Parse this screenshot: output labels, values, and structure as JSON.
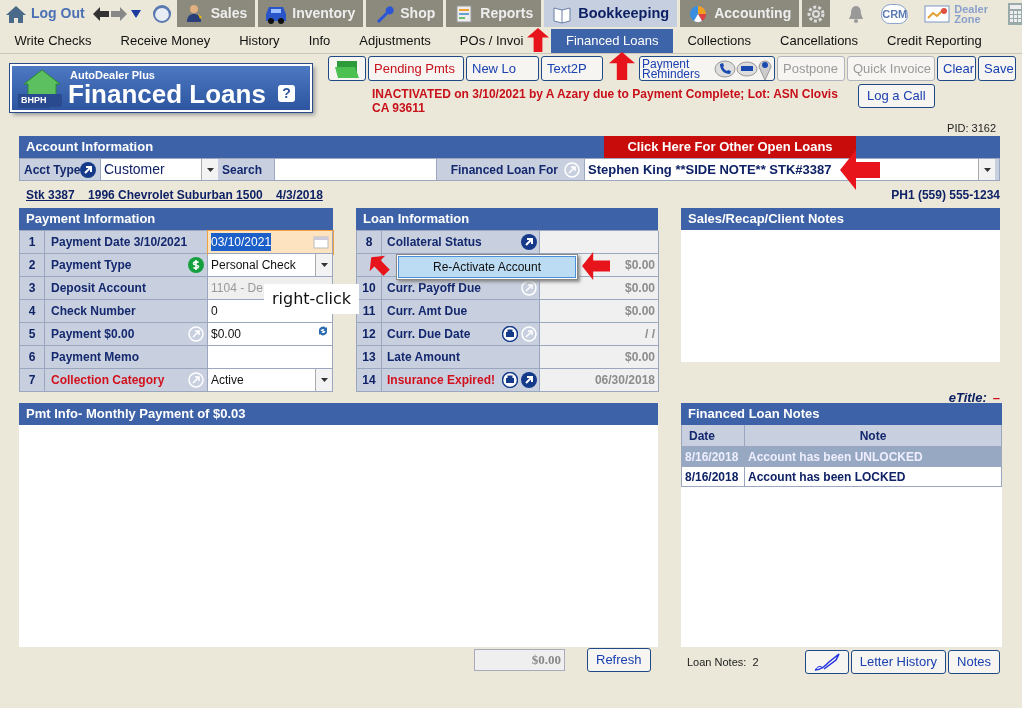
{
  "header": {
    "logout": "Log Out",
    "modules": [
      {
        "label": "Sales",
        "kind": "sales",
        "selected": false
      },
      {
        "label": "Inventory",
        "kind": "inventory",
        "selected": false
      },
      {
        "label": "Shop",
        "kind": "shop",
        "selected": false
      },
      {
        "label": "Reports",
        "kind": "reports",
        "selected": false
      },
      {
        "label": "Bookkeeping",
        "kind": "bookkeeping",
        "selected": true
      },
      {
        "label": "Accounting",
        "kind": "accounting",
        "selected": false
      }
    ],
    "crm": "CRM",
    "dealer_zone": "Dealer Zone"
  },
  "subnav": [
    {
      "label": "Write Checks",
      "selected": false
    },
    {
      "label": "Receive Money",
      "selected": false
    },
    {
      "label": "History",
      "selected": false
    },
    {
      "label": "Info",
      "selected": false
    },
    {
      "label": "Adjustments",
      "selected": false
    },
    {
      "label": "POs / Invoi",
      "selected": false
    },
    {
      "label": "Financed Loans",
      "selected": true
    },
    {
      "label": "Collections",
      "selected": false
    },
    {
      "label": "Cancellations",
      "selected": false
    },
    {
      "label": "Credit Reporting",
      "selected": false
    }
  ],
  "logo": {
    "badge": "BHPH",
    "brand": "AutoDealer Plus",
    "title": "Financed Loans",
    "help": "?"
  },
  "toolbar": [
    {
      "kind": "folder",
      "alert": false,
      "disabled": false
    },
    {
      "kind": "text",
      "label": "Pending Pmts",
      "alert": true,
      "disabled": false
    },
    {
      "kind": "text",
      "label": "New Lo",
      "alert": false,
      "disabled": false
    },
    {
      "kind": "text",
      "label": "Text2P",
      "alert": false,
      "disabled": false
    },
    {
      "kind": "reminders",
      "label": "Payment Reminders",
      "alert": false,
      "disabled": false
    },
    {
      "kind": "text",
      "label": "Postpone",
      "alert": false,
      "disabled": true
    },
    {
      "kind": "text",
      "label": "Quick Invoice",
      "alert": false,
      "disabled": true
    },
    {
      "kind": "text",
      "label": "Clear",
      "alert": false,
      "disabled": false
    },
    {
      "kind": "text",
      "label": "Save",
      "alert": false,
      "disabled": false
    }
  ],
  "status_message": "INACTIVATED on 3/10/2021 by A Azary due to Payment Complete; Lot: ASN Clovis CA 93611",
  "log_call": "Log a Call",
  "pid": "PID: 3162",
  "account": {
    "title": "Account Information",
    "other_loans": "Click Here For Other Open Loans",
    "acct_type_label": "Acct Type",
    "acct_type": "Customer",
    "search_label": "Search",
    "loan_for_label": "Financed Loan For",
    "loan_for": "Stephen King **SIDE NOTE** STK#3387"
  },
  "vehicle_link": "Stk 3387    1996 Chevrolet Suburban 1500    4/3/2018",
  "phone": "PH1 (559) 555-1234",
  "payment": {
    "title": "Payment Information",
    "rows": [
      {
        "num": "1",
        "label": "Payment Date  3/10/2021",
        "alert": false,
        "kind": "date",
        "value": "03/10/2021"
      },
      {
        "num": "2",
        "label": "Payment Type",
        "alert": false,
        "kind": "select",
        "value": "Personal Check"
      },
      {
        "num": "3",
        "label": "Deposit Account",
        "alert": false,
        "kind": "locked",
        "value": "1104 - De"
      },
      {
        "num": "4",
        "label": "Check Number",
        "alert": false,
        "kind": "text",
        "value": "0"
      },
      {
        "num": "5",
        "label": "Payment  $0.00",
        "alert": false,
        "kind": "amount",
        "value": "$0.00"
      },
      {
        "num": "6",
        "label": "Payment Memo",
        "alert": false,
        "kind": "text",
        "value": ""
      },
      {
        "num": "7",
        "label": "Collection Category",
        "alert": true,
        "kind": "select",
        "value": "Active"
      }
    ]
  },
  "loan": {
    "title": "Loan Information",
    "rows": [
      {
        "num": "8",
        "label": "Collateral Status",
        "alert": false,
        "value": ""
      },
      {
        "num": "",
        "label": "",
        "alert": false,
        "value": "$0.00"
      },
      {
        "num": "10",
        "label": "Curr. Payoff Due",
        "alert": false,
        "value": "$0.00"
      },
      {
        "num": "11",
        "label": "Curr. Amt Due",
        "alert": false,
        "value": "$0.00"
      },
      {
        "num": "12",
        "label": "Curr. Due Date",
        "alert": false,
        "value": "/  /"
      },
      {
        "num": "13",
        "label": "Late Amount",
        "alert": false,
        "value": "$0.00"
      },
      {
        "num": "14",
        "label": "Insurance Expired!",
        "alert": true,
        "value": "06/30/2018"
      }
    ]
  },
  "client_notes": {
    "title": "Sales/Recap/Client Notes"
  },
  "etitle": {
    "label": "eTitle:",
    "value": "–"
  },
  "pmt_info": {
    "title": "Pmt Info- Monthly Payment of $0.03",
    "total": "$0.00",
    "refresh": "Refresh"
  },
  "loan_notes": {
    "title": "Financed Loan Notes",
    "columns": [
      "Date",
      "Note"
    ],
    "rows": [
      {
        "date": "8/16/2018",
        "note": "Account has been UNLOCKED",
        "selected": true
      },
      {
        "date": "8/16/2018",
        "note": "Account has been LOCKED",
        "selected": false
      }
    ],
    "count_label": "Loan Notes:  2",
    "buttons": [
      "Letter History",
      "Notes"
    ]
  },
  "context_menu": {
    "items": [
      {
        "label": "Re-Activate Account",
        "selected": true
      }
    ]
  },
  "callout": "right-click"
}
